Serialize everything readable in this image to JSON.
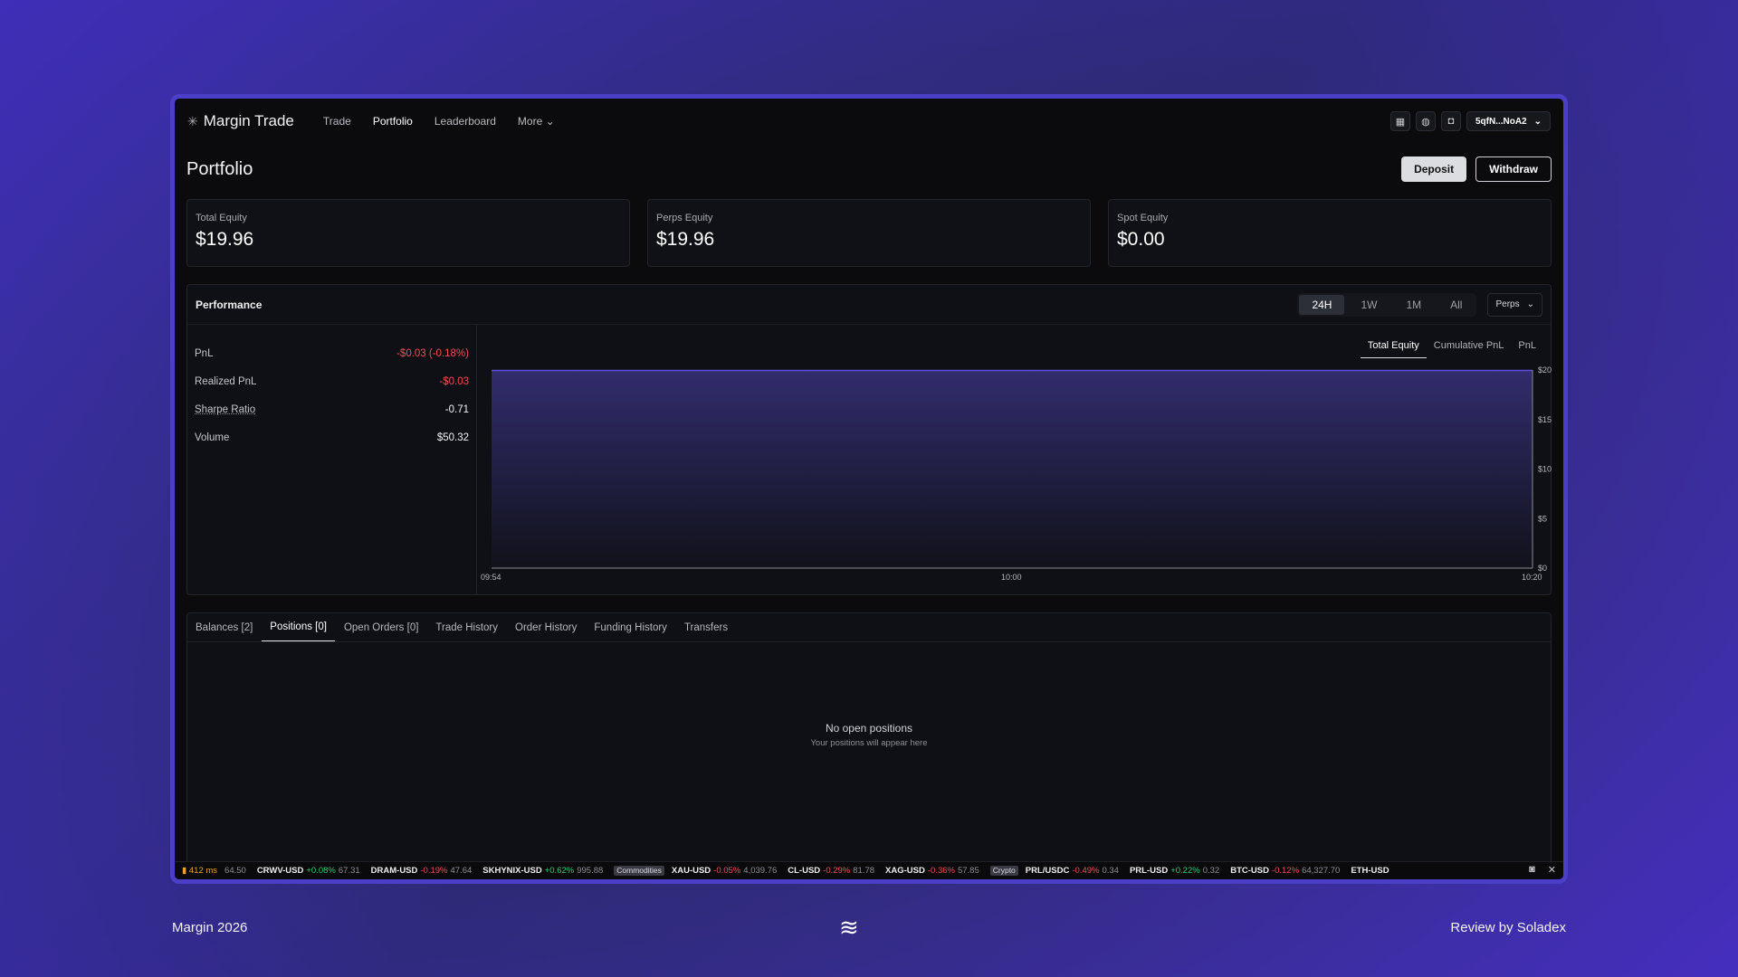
{
  "app": {
    "name": "Margin Trade"
  },
  "nav": {
    "links": [
      "Trade",
      "Portfolio",
      "Leaderboard",
      "More"
    ],
    "wallet": "5qfN...NoA2"
  },
  "page": {
    "title": "Portfolio",
    "deposit": "Deposit",
    "withdraw": "Withdraw"
  },
  "cards": [
    {
      "label": "Total Equity",
      "value": "$19.96"
    },
    {
      "label": "Perps Equity",
      "value": "$19.96"
    },
    {
      "label": "Spot Equity",
      "value": "$0.00"
    }
  ],
  "performance": {
    "title": "Performance",
    "ranges": [
      "24H",
      "1W",
      "1M",
      "All"
    ],
    "active_range": "24H",
    "market": "Perps",
    "stats": [
      {
        "label": "PnL",
        "value": "-$0.03 (-0.18%)",
        "tone": "neg"
      },
      {
        "label": "Realized PnL",
        "value": "-$0.03",
        "tone": "neg"
      },
      {
        "label": "Sharpe Ratio",
        "value": "-0.71",
        "tone": "neutral"
      },
      {
        "label": "Volume",
        "value": "$50.32",
        "tone": "neutral"
      }
    ],
    "chart_tabs": [
      "Total Equity",
      "Cumulative PnL",
      "PnL"
    ]
  },
  "chart_data": {
    "type": "area",
    "x": [
      "09:54",
      "10:00",
      "10:20"
    ],
    "y_ticks": [
      "$20",
      "$15",
      "$10",
      "$5",
      "$0"
    ],
    "ylim": [
      0,
      20
    ],
    "series": [
      {
        "values": [
          19.96,
          19.96,
          19.96
        ]
      }
    ],
    "color": "#5b4fd8"
  },
  "orders": {
    "tabs": [
      "Balances [2]",
      "Positions [0]",
      "Open Orders [0]",
      "Trade History",
      "Order History",
      "Funding History",
      "Transfers"
    ],
    "empty_title": "No open positions",
    "empty_sub": "Your positions will appear here"
  },
  "ticker": {
    "latency": "412 ms",
    "lead": "64.50",
    "items": [
      {
        "sym": "CRWV-USD",
        "chg": "+0.08%",
        "px": "67.31",
        "dir": "up"
      },
      {
        "sym": "DRAM-USD",
        "chg": "-0.19%",
        "px": "47.64",
        "dir": "dn"
      },
      {
        "sym": "SKHYNIX-USD",
        "chg": "+0.62%",
        "px": "995.88",
        "dir": "up"
      },
      {
        "tag": "Commodities"
      },
      {
        "sym": "XAU-USD",
        "chg": "-0.05%",
        "px": "4,039.76",
        "dir": "dn"
      },
      {
        "sym": "CL-USD",
        "chg": "-0.29%",
        "px": "81.78",
        "dir": "dn"
      },
      {
        "sym": "XAG-USD",
        "chg": "-0.36%",
        "px": "57.85",
        "dir": "dn"
      },
      {
        "tag": "Crypto"
      },
      {
        "sym": "PRL/USDC",
        "chg": "-0.49%",
        "px": "0.34",
        "dir": "dn"
      },
      {
        "sym": "PRL-USD",
        "chg": "+0.22%",
        "px": "0.32",
        "dir": "up"
      },
      {
        "sym": "BTC-USD",
        "chg": "-0.12%",
        "px": "64,327.70",
        "dir": "dn"
      },
      {
        "sym": "ETH-USD",
        "chg": "",
        "px": "",
        "dir": "dn"
      }
    ]
  },
  "footer": {
    "left": "Margin 2026",
    "right": "Review by Soladex"
  }
}
